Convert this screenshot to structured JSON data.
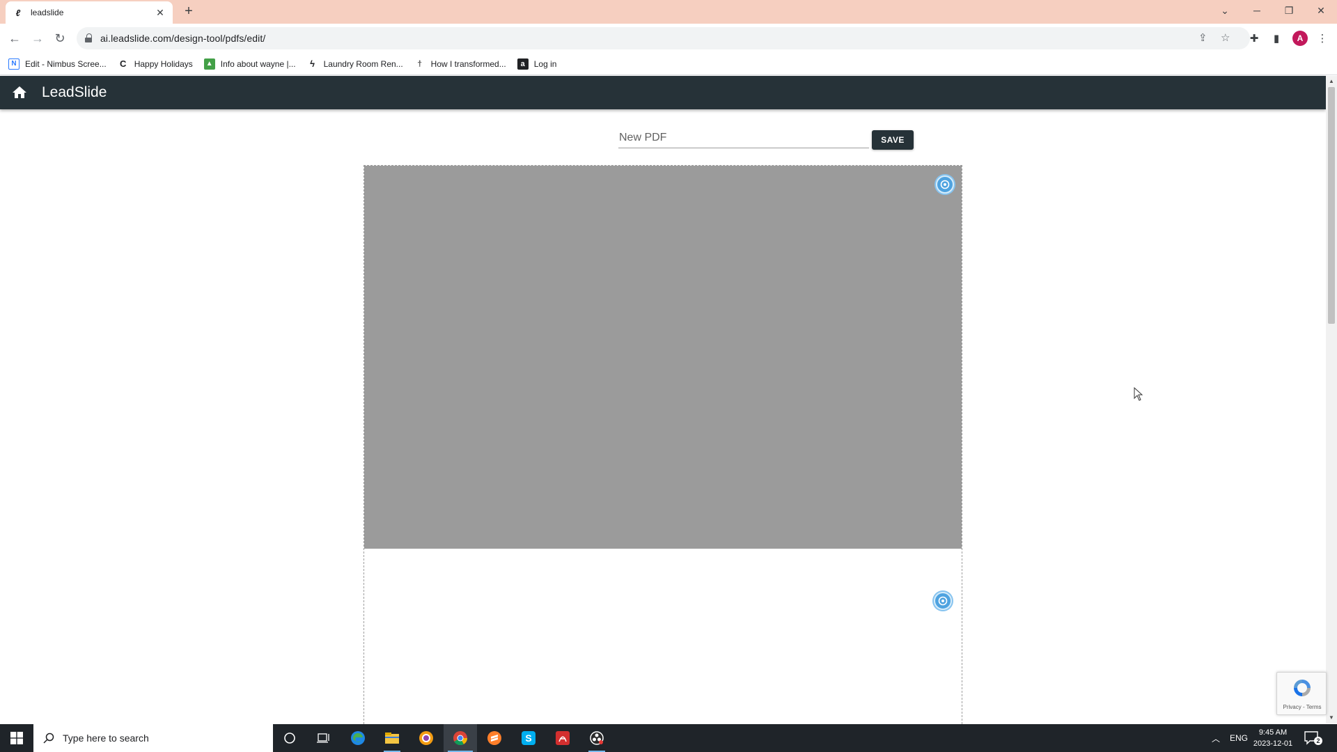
{
  "browser": {
    "tab_title": "leadslide",
    "tab_close": "✕",
    "new_tab": "+",
    "url": "ai.leadslide.com/design-tool/pdfs/edit/",
    "avatar_letter": "A",
    "bookmarks": [
      {
        "label": "Edit - Nimbus Scree...",
        "icon": "N",
        "color": "#2979ff"
      },
      {
        "label": "Happy Holidays",
        "icon": "C",
        "color": "#202124"
      },
      {
        "label": "Info about wayne |...",
        "icon": "▲",
        "color": "#43a047"
      },
      {
        "label": "Laundry Room Ren...",
        "icon": "ϟ",
        "color": "#202124"
      },
      {
        "label": "How I transformed...",
        "icon": "ϯ",
        "color": "#616161"
      },
      {
        "label": "Log in",
        "icon": "a",
        "color": "#202124"
      }
    ]
  },
  "app": {
    "title": "LeadSlide",
    "header_color": "#263238"
  },
  "editor": {
    "name_value": "New PDF",
    "save_label": "SAVE",
    "image_placeholder_color": "#9b9b9b",
    "accent_color": "#4fa3e0"
  },
  "recaptcha": {
    "footer": "Privacy - Terms"
  },
  "taskbar": {
    "search_placeholder": "Type here to search",
    "language": "ENG",
    "time": "9:45 AM",
    "date": "2023-12-01",
    "notification_count": "2"
  }
}
